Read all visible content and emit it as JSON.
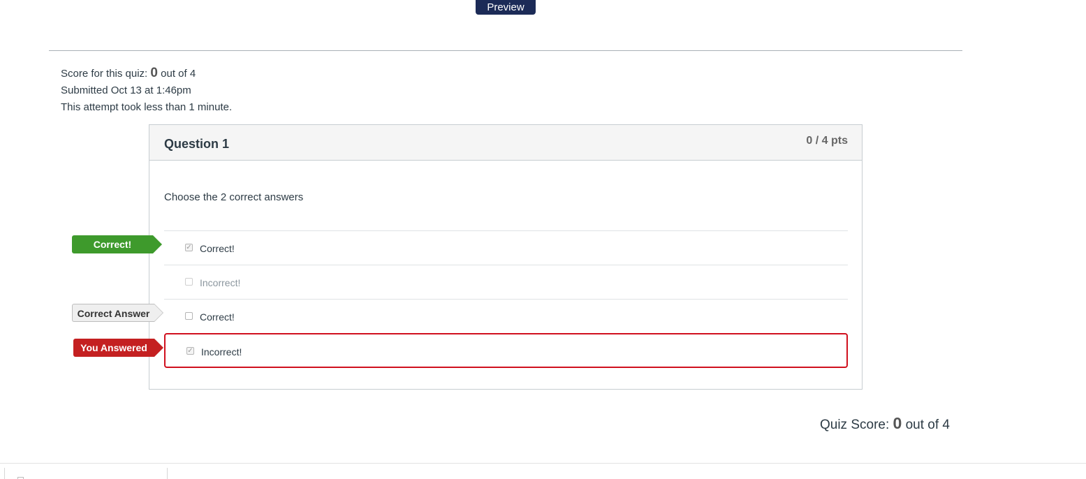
{
  "toolbar": {
    "preview_label": "Preview"
  },
  "summary": {
    "score_prefix": "Score for this quiz: ",
    "score_value": "0",
    "score_suffix": " out of 4",
    "submitted": "Submitted Oct 13 at 1:46pm",
    "duration": "This attempt took less than 1 minute."
  },
  "question": {
    "title": "Question 1",
    "points": "0 / 4 pts",
    "prompt": "Choose the 2 correct answers",
    "answers": [
      {
        "label": "Correct!",
        "checked": true,
        "state": "correct"
      },
      {
        "label": "Incorrect!",
        "checked": false,
        "state": "muted"
      },
      {
        "label": "Correct!",
        "checked": false,
        "state": "correct-answer"
      },
      {
        "label": "Incorrect!",
        "checked": true,
        "state": "you-answered"
      }
    ]
  },
  "flags": {
    "correct": "Correct!",
    "correct_answer": "Correct Answer",
    "you_answered": "You Answered"
  },
  "footer": {
    "quiz_score_prefix": "Quiz Score: ",
    "quiz_score_value": "0",
    "quiz_score_suffix": " out of 4"
  },
  "colors": {
    "preview_bg": "#1c2b57",
    "correct_flag": "#3e9a2c",
    "you_answered_flag": "#c42021",
    "wrong_border": "#d0101e"
  }
}
